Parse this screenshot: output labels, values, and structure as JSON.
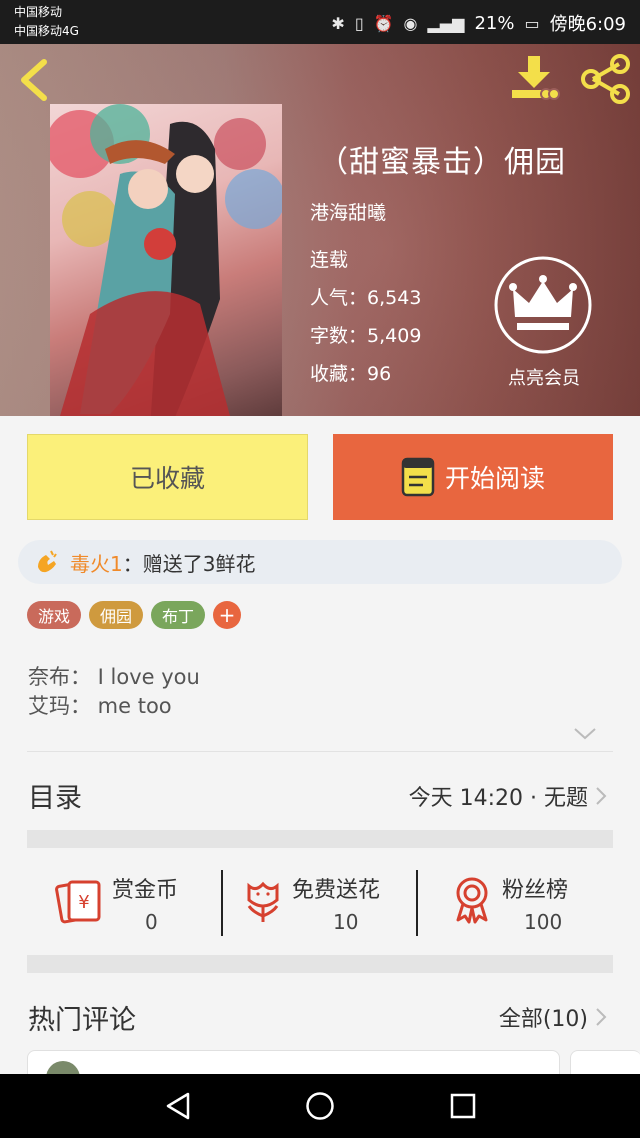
{
  "status_bar": {
    "carrier1": "中国移动",
    "carrier2": "中国移动4G",
    "battery": "21%",
    "time": "傍晚6:09"
  },
  "book": {
    "title": "（甜蜜暴击）佣园",
    "author": "港海甜曦",
    "status": "连载",
    "stats": [
      {
        "label": "人气：",
        "value": "6,543"
      },
      {
        "label": "字数：",
        "value": "5,409"
      },
      {
        "label": "收藏：",
        "value": "96"
      }
    ],
    "vip_label": "点亮会员"
  },
  "actions": {
    "favorited_label": "已收藏",
    "start_reading_label": "开始阅读"
  },
  "gift": {
    "user": "毒火1",
    "text": "：赠送了3鲜花"
  },
  "tags": [
    {
      "label": "游戏",
      "color": "#c96a5b"
    },
    {
      "label": "佣园",
      "color": "#cf9a3e"
    },
    {
      "label": "布丁",
      "color": "#7aa65c"
    }
  ],
  "tag_add": "+",
  "description": [
    "奈布： I love you",
    "艾玛： me too"
  ],
  "catalog": {
    "title": "目录",
    "latest": "今天 14:20 · 无题"
  },
  "stats_row": [
    {
      "label": "赏金币",
      "value": "0",
      "icon": "red-envelope-icon"
    },
    {
      "label": "免费送花",
      "value": "10",
      "icon": "flower-icon"
    },
    {
      "label": "粉丝榜",
      "value": "100",
      "icon": "ribbon-badge-icon"
    }
  ],
  "comments": {
    "title": "热门评论",
    "all_label": "全部(10)"
  },
  "colors": {
    "accent_orange": "#e8663f",
    "fav_yellow": "#fbf07a",
    "icon_yellow": "#f3df4a",
    "icon_red": "#d6412f"
  }
}
